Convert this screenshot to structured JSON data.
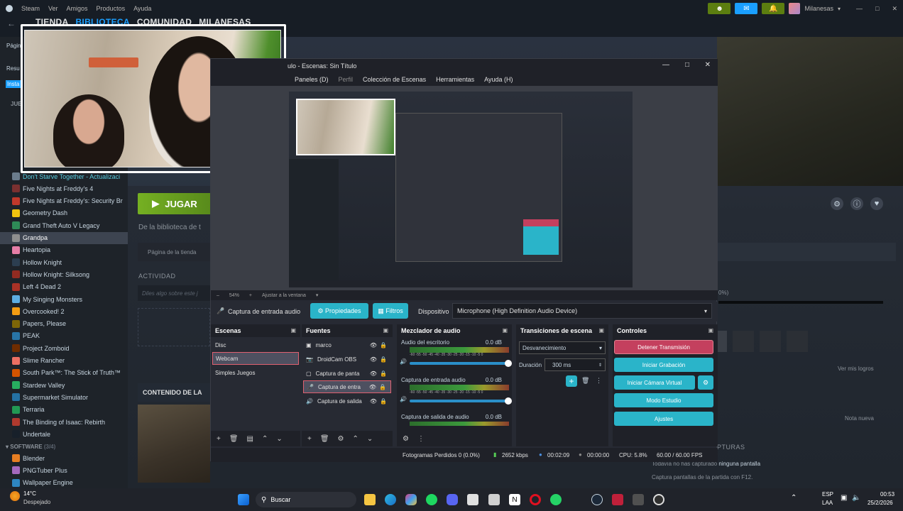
{
  "steam": {
    "menu": [
      "Steam",
      "Ver",
      "Amigos",
      "Productos",
      "Ayuda"
    ],
    "nav_tabs": [
      "TIENDA",
      "BIBLIOTECA",
      "COMUNIDAD",
      "MILANESAS"
    ],
    "username": "Milanesas",
    "window_buttons": [
      "—",
      "□",
      "✕"
    ],
    "sidebar": {
      "cut_labels": [
        "Págin",
        "Resu",
        "Insta"
      ],
      "section_games_short": "JUE",
      "games": [
        {
          "label": "Don't Starve Together - Actualizaci",
          "color": "#6b7c8c",
          "highlight": true
        },
        {
          "label": "Five Nights at Freddy's 4",
          "color": "#7a3030"
        },
        {
          "label": "Five Nights at Freddy's: Security Br",
          "color": "#c0392b"
        },
        {
          "label": "Geometry Dash",
          "color": "#f1c40f"
        },
        {
          "label": "Grand Theft Auto V Legacy",
          "color": "#2e8b57"
        },
        {
          "label": "Grandpa",
          "color": "#8e8e8e",
          "selected": true
        },
        {
          "label": "Heartopia",
          "color": "#e67ea7"
        },
        {
          "label": "Hollow Knight",
          "color": "#2c3e50"
        },
        {
          "label": "Hollow Knight: Silksong",
          "color": "#922b21"
        },
        {
          "label": "Left 4 Dead 2",
          "color": "#a93226"
        },
        {
          "label": "My Singing Monsters",
          "color": "#5dade2"
        },
        {
          "label": "Overcooked! 2",
          "color": "#f39c12"
        },
        {
          "label": "Papers, Please",
          "color": "#7d6608"
        },
        {
          "label": "PEAK",
          "color": "#2874a6"
        },
        {
          "label": "Project Zomboid",
          "color": "#6e2c00"
        },
        {
          "label": "Slime Rancher",
          "color": "#ec7063"
        },
        {
          "label": "South Park™: The Stick of Truth™",
          "color": "#d35400"
        },
        {
          "label": "Stardew Valley",
          "color": "#27ae60"
        },
        {
          "label": "Supermarket Simulator",
          "color": "#2471a3"
        },
        {
          "label": "Terraria",
          "color": "#229954"
        },
        {
          "label": "The Binding of Isaac: Rebirth",
          "color": "#b03a2e"
        },
        {
          "label": "Undertale",
          "color": "#17202a"
        }
      ],
      "section_software": "SOFTWARE",
      "software_count": "(3/4)",
      "software": [
        {
          "label": "Blender",
          "color": "#e67e22"
        },
        {
          "label": "PNGTuber Plus",
          "color": "#a569bd"
        },
        {
          "label": "Wallpaper Engine",
          "color": "#2e86c1"
        }
      ]
    },
    "main": {
      "play_label": "JUGAR",
      "library_text": "De la biblioteca de t",
      "store_page": "Página de la tienda",
      "activity_label": "ACTIVIDAD",
      "activity_placeholder": "Diles algo sobre este j",
      "content_label": "CONTENIDO DE LA",
      "percent_text": "0%)",
      "achievements_link": "Ver mis logros",
      "new_note": "Nota nueva",
      "captures_label": "PTURAS",
      "captures_text_1": "Todavía no has capturado",
      "captures_text_1_b": "ninguna pantalla",
      "captures_text_2": "Captura pantallas de la partida con F12."
    }
  },
  "obs": {
    "title": "ulo - Escenas: Sin Título",
    "menu": [
      "Paneles (D)",
      "Perfil",
      "Colección de Escenas",
      "Herramientas",
      "Ayuda (H)"
    ],
    "zoom": "54%",
    "fit_label": "Ajustar a la ventana",
    "source_bar": {
      "source_name": "Captura de entrada audio",
      "properties_btn": "Propiedades",
      "filters_btn": "Filtros",
      "device_label": "Dispositivo",
      "device_value": "Microphone (High Definition Audio Device)"
    },
    "scenes": {
      "title": "Escenas",
      "items": [
        "Disc",
        "Webcam",
        "Simples Juegos"
      ],
      "selected": 1
    },
    "sources": {
      "title": "Fuentes",
      "items": [
        "marco",
        "DroidCam OBS",
        "Captura de panta",
        "Captura de entra",
        "Captura de salida"
      ]
    },
    "mixer": {
      "title": "Mezclador de audio",
      "channels": [
        {
          "name": "Audio del escritorio",
          "db": "0.0 dB",
          "level": 0.0
        },
        {
          "name": "Captura de entrada audio",
          "db": "0.0 dB",
          "level": 0.0
        },
        {
          "name": "Captura de salida de audio",
          "db": "0.0 dB",
          "level": 0.0
        }
      ],
      "scale": "-60 -55 -50 -45 -40 -35 -30 -25 -20 -15 -10 -5 0"
    },
    "transitions": {
      "title": "Transiciones de escena",
      "type": "Desvanecimiento",
      "duration_label": "Duración",
      "duration_value": "300 ms"
    },
    "controls": {
      "title": "Controles",
      "buttons": [
        "Detener Transmisión",
        "Iniciar Grabación",
        "Iniciar Cámara Virtual",
        "Modo Estudio",
        "Ajustes"
      ]
    },
    "status": {
      "dropped": "Fotogramas Perdidos 0 (0.0%)",
      "bitrate": "2652 kbps",
      "live_time": "00:02:09",
      "rec_time": "00:00:00",
      "cpu": "CPU: 5.8%",
      "fps": "60.00 / 60.00 FPS"
    }
  },
  "taskbar": {
    "weather_temp": "14°C",
    "weather_desc": "Despejado",
    "search": "Buscar",
    "lang_1": "ESP",
    "lang_2": "LAA",
    "time": "00:53",
    "date": "25/2/2026"
  },
  "colors": {
    "teal": "#2ab4c9",
    "stop_stream": "#c4405e",
    "steam_green": "#5c7e10",
    "steam_blue": "#1a9fff"
  }
}
